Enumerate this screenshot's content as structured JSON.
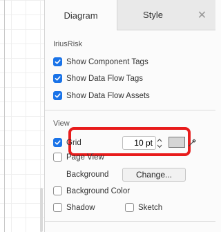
{
  "tabs": {
    "diagram": "Diagram",
    "style": "Style",
    "close": "✕"
  },
  "iriusrisk": {
    "title": "IriusRisk",
    "items": [
      {
        "label": "Show Component Tags",
        "checked": true
      },
      {
        "label": "Show Data Flow Tags",
        "checked": true
      },
      {
        "label": "Show Data Flow Assets",
        "checked": true
      }
    ]
  },
  "view": {
    "title": "View",
    "grid_label": "Grid",
    "grid_checked": true,
    "grid_size": "10 pt",
    "grid_color": "#d5d5d5",
    "page_view_label": "Page View",
    "page_view_checked": false,
    "background_label": "Background",
    "change_button": "Change...",
    "background_color_label": "Background Color",
    "background_color_checked": false,
    "shadow_label": "Shadow",
    "shadow_checked": false,
    "sketch_label": "Sketch",
    "sketch_checked": false
  },
  "colors": {
    "accent": "#1a73e8",
    "highlight": "#e81c1c"
  },
  "icons": {
    "checkbox_checked": "checkmark-icon",
    "spinner": "spinner-arrows-icon",
    "picker": "eyedropper-icon"
  }
}
